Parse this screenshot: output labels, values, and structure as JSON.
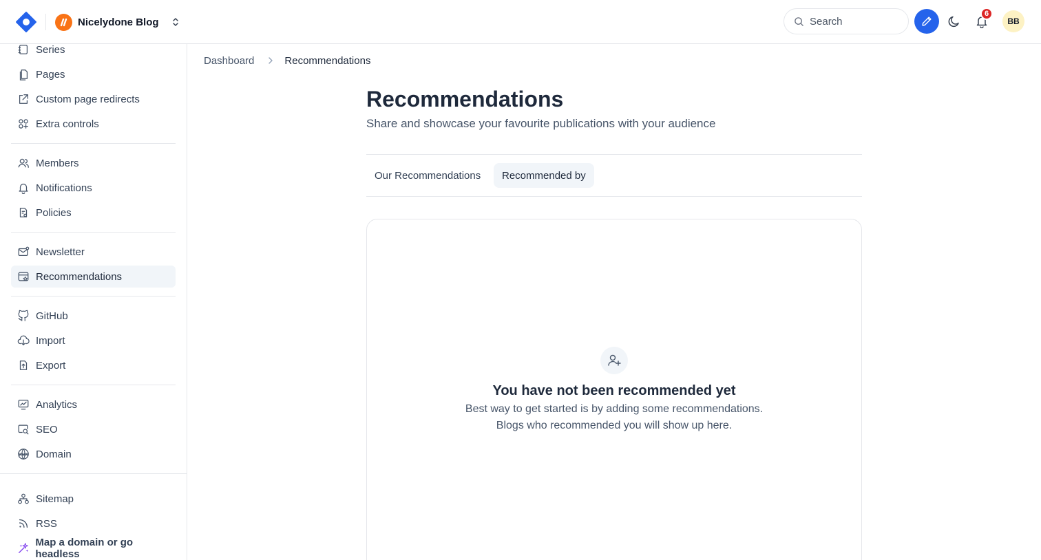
{
  "header": {
    "blog_name": "Nicelydone Blog",
    "search_label": "Search",
    "notification_count": "6",
    "user_initials": "BB",
    "accent_color": "#2563eb",
    "blog_avatar_color": "#f97316"
  },
  "sidebar": {
    "groups": [
      [
        {
          "label": "Series",
          "icon": "series-icon"
        },
        {
          "label": "Pages",
          "icon": "pages-icon"
        },
        {
          "label": "Custom page redirects",
          "icon": "redirect-icon"
        },
        {
          "label": "Extra controls",
          "icon": "extra-controls-icon"
        }
      ],
      [
        {
          "label": "Members",
          "icon": "members-icon"
        },
        {
          "label": "Notifications",
          "icon": "bell-icon"
        },
        {
          "label": "Policies",
          "icon": "policies-icon"
        }
      ],
      [
        {
          "label": "Newsletter",
          "icon": "newsletter-icon"
        },
        {
          "label": "Recommendations",
          "icon": "recommendations-icon",
          "active": true
        }
      ],
      [
        {
          "label": "GitHub",
          "icon": "github-icon"
        },
        {
          "label": "Import",
          "icon": "import-icon"
        },
        {
          "label": "Export",
          "icon": "export-icon"
        }
      ],
      [
        {
          "label": "Analytics",
          "icon": "analytics-icon"
        },
        {
          "label": "SEO",
          "icon": "seo-icon"
        },
        {
          "label": "Domain",
          "icon": "domain-icon"
        }
      ],
      [
        {
          "label": "Sitemap",
          "icon": "sitemap-icon"
        },
        {
          "label": "RSS",
          "icon": "rss-icon"
        },
        {
          "label": "Map a domain or go headless",
          "icon": "sparkle-icon"
        }
      ]
    ]
  },
  "breadcrumb": {
    "parent": "Dashboard",
    "current": "Recommendations"
  },
  "main": {
    "title": "Recommendations",
    "subtitle": "Share and showcase your favourite publications with your audience",
    "tabs": [
      {
        "label": "Our Recommendations",
        "active": false
      },
      {
        "label": "Recommended by",
        "active": true
      }
    ],
    "empty_state": {
      "title": "You have not been recommended yet",
      "line1": "Best way to get started is by adding some recommendations.",
      "line2": "Blogs who recommended you will show up here."
    }
  }
}
